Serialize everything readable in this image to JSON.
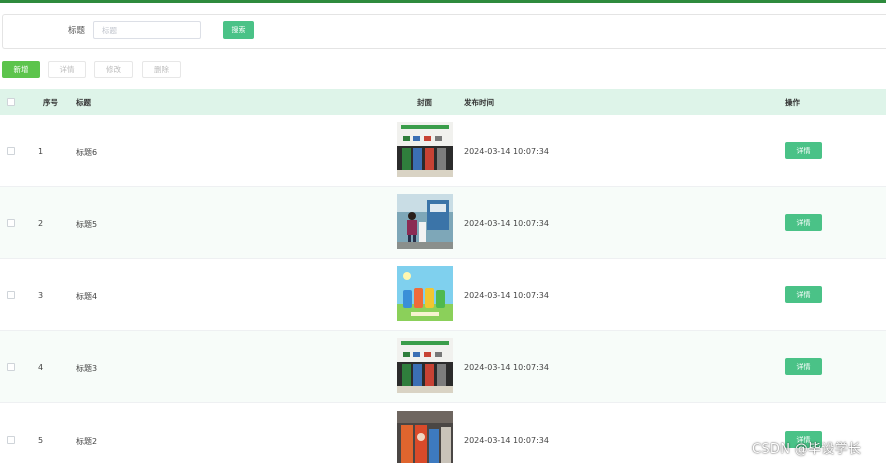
{
  "search": {
    "label": "标题",
    "placeholder": "标题",
    "button_label": "搜索"
  },
  "toolbar": {
    "add_label": "新增",
    "detail_label": "详情",
    "edit_label": "修改",
    "delete_label": "删除"
  },
  "table": {
    "headers": {
      "index": "序号",
      "title": "标题",
      "cover": "封面",
      "time": "发布时间",
      "action": "操作"
    },
    "action_label": "详情",
    "rows": [
      {
        "index": "1",
        "title": "标题6",
        "time": "2024-03-14 10:07:34",
        "cover": "garbage-bins-poster"
      },
      {
        "index": "2",
        "title": "标题5",
        "time": "2024-03-14 10:07:34",
        "cover": "people-at-bins"
      },
      {
        "index": "3",
        "title": "标题4",
        "time": "2024-03-14 10:07:34",
        "cover": "cartoon-bins"
      },
      {
        "index": "4",
        "title": "标题3",
        "time": "2024-03-14 10:07:34",
        "cover": "garbage-bins-poster"
      },
      {
        "index": "5",
        "title": "标题2",
        "time": "2024-03-14 10:07:34",
        "cover": "orange-bins"
      }
    ]
  },
  "watermark": "CSDN @毕设学长",
  "colors": {
    "topbar": "#2e8b3d",
    "primary": "#4ac287",
    "add": "#5cc44c",
    "header_bg": "#def4e9"
  }
}
